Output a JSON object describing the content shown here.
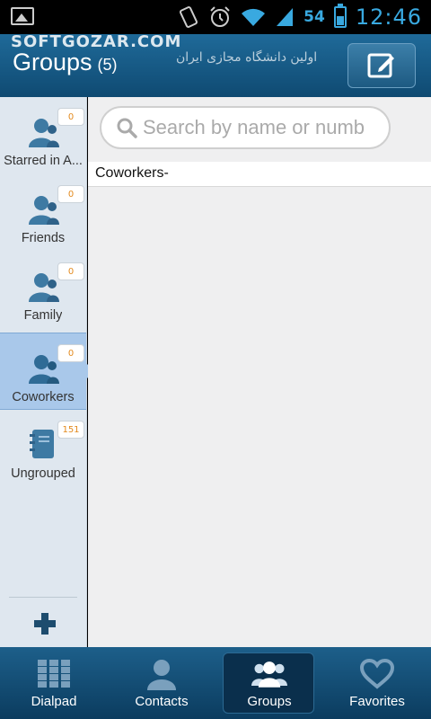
{
  "status_bar": {
    "battery": "54",
    "time": "12:46"
  },
  "watermark": {
    "text": "SOFTGOZAR.COM",
    "subtext": "اولین دانشگاه مجازی ایران"
  },
  "header": {
    "title": "Groups",
    "count": "(5)",
    "compose_icon": "compose-icon"
  },
  "groups": [
    {
      "name": "Starred in A...",
      "count": "0",
      "icon": "contact-group-icon"
    },
    {
      "name": "Friends",
      "count": "0",
      "icon": "contact-group-icon"
    },
    {
      "name": "Family",
      "count": "0",
      "icon": "contact-group-icon"
    },
    {
      "name": "Coworkers",
      "count": "0",
      "icon": "contact-group-icon"
    },
    {
      "name": "Ungrouped",
      "count": "151",
      "icon": "address-book-icon"
    }
  ],
  "selected_group": "Coworkers",
  "search": {
    "placeholder": "Search by name or numb"
  },
  "section": {
    "label": "Coworkers-"
  },
  "bottom_nav": [
    {
      "label": "Dialpad",
      "icon": "dialpad-icon"
    },
    {
      "label": "Contacts",
      "icon": "contacts-icon"
    },
    {
      "label": "Groups",
      "icon": "groups-icon"
    },
    {
      "label": "Favorites",
      "icon": "heart-icon"
    }
  ],
  "colors": {
    "header": "#1a5f8c",
    "accent": "#39a9e0",
    "badge_text": "#e38a1e",
    "active_group": "#a9c8ea"
  }
}
